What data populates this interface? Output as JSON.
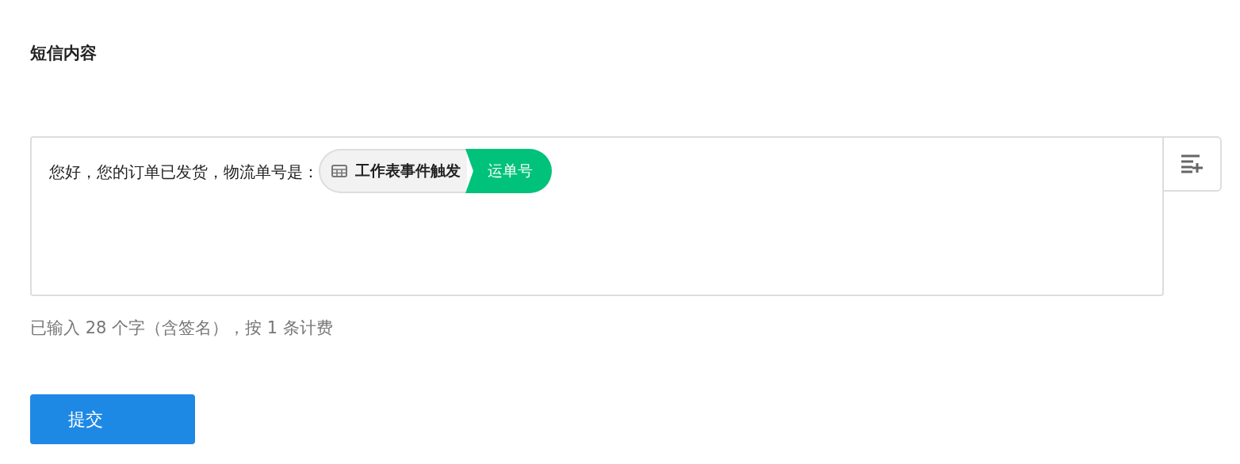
{
  "section_title": "短信内容",
  "editor": {
    "text": "您好，您的订单已发货，物流单号是：",
    "tag": {
      "source": "工作表事件触发",
      "field": "运单号"
    }
  },
  "counter": "已输入 28 个字（含签名），按 1 条计费",
  "submit_button": "提交"
}
